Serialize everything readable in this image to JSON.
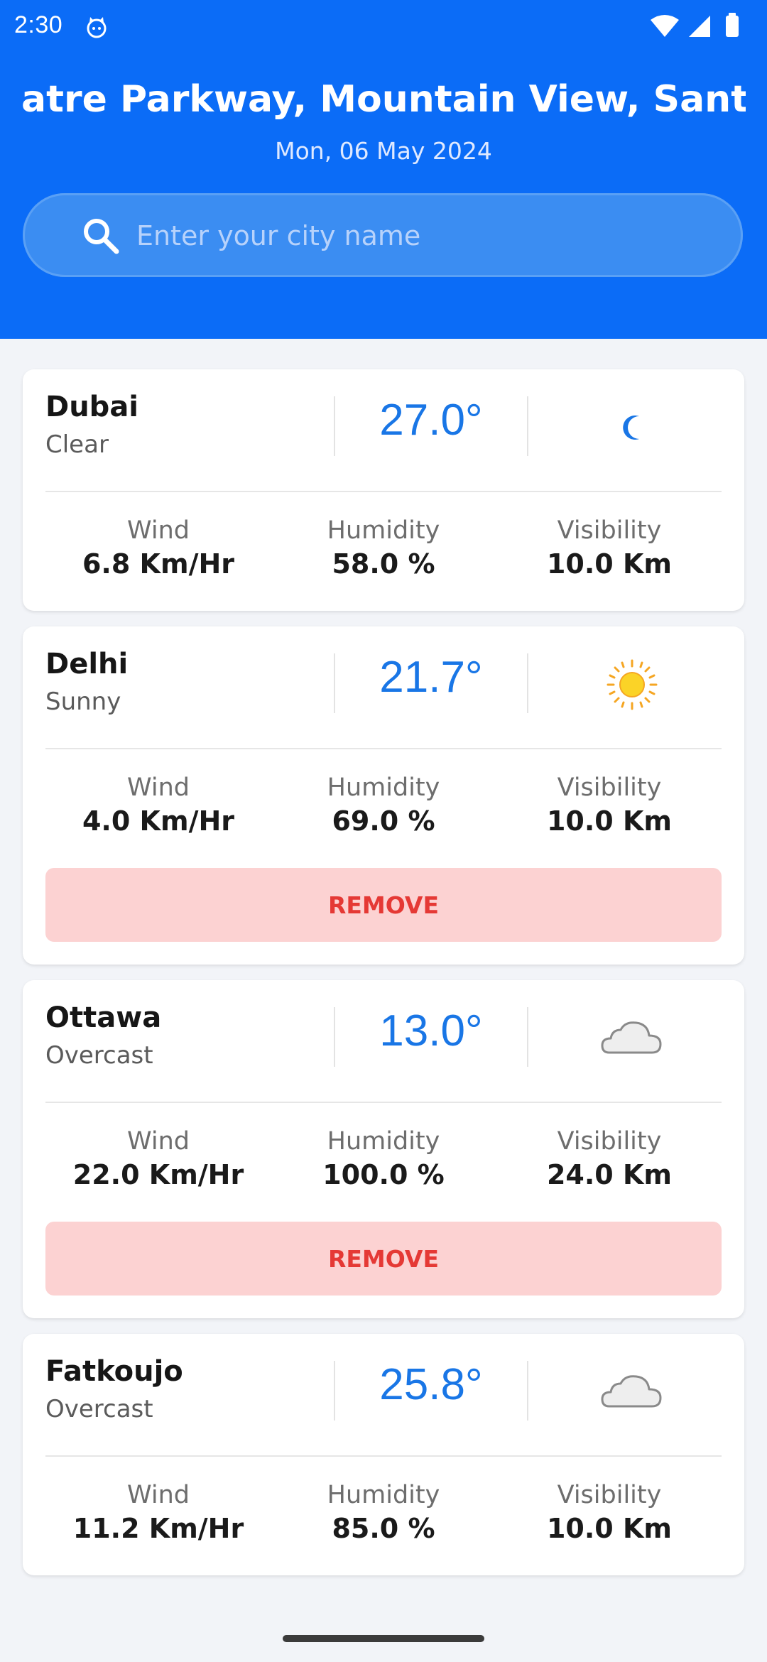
{
  "status_bar": {
    "time": "2:30"
  },
  "header": {
    "location": "atre Parkway, Mountain View, Santa Clara",
    "date": "Mon, 06 May 2024"
  },
  "search": {
    "placeholder": "Enter your city name"
  },
  "colors": {
    "header_bg": "#0b6cf7",
    "temp": "#1976e6",
    "remove_bg": "#fcd2d2",
    "remove_text": "#e53935"
  },
  "cards": [
    {
      "city": "Dubai",
      "condition": "Clear",
      "temperature": "27.0°",
      "icon": "moon-icon",
      "wind_label": "Wind",
      "wind": "6.8 Km/Hr",
      "humidity_label": "Humidity",
      "humidity": "58.0 %",
      "visibility_label": "Visibility",
      "visibility": "10.0 Km"
    },
    {
      "city": "Delhi",
      "condition": "Sunny",
      "temperature": "21.7°",
      "icon": "sun-icon",
      "wind_label": "Wind",
      "wind": "4.0 Km/Hr",
      "humidity_label": "Humidity",
      "humidity": "69.0 %",
      "visibility_label": "Visibility",
      "visibility": "10.0 Km",
      "remove_label": "REMOVE"
    },
    {
      "city": "Ottawa",
      "condition": "Overcast",
      "temperature": "13.0°",
      "icon": "cloud-icon",
      "wind_label": "Wind",
      "wind": "22.0 Km/Hr",
      "humidity_label": "Humidity",
      "humidity": "100.0 %",
      "visibility_label": "Visibility",
      "visibility": "24.0 Km",
      "remove_label": "REMOVE"
    },
    {
      "city": "Fatkoujo",
      "condition": "Overcast",
      "temperature": "25.8°",
      "icon": "cloud-icon",
      "wind_label": "Wind",
      "wind": "11.2 Km/Hr",
      "humidity_label": "Humidity",
      "humidity": "85.0 %",
      "visibility_label": "Visibility",
      "visibility": "10.0 Km"
    }
  ]
}
